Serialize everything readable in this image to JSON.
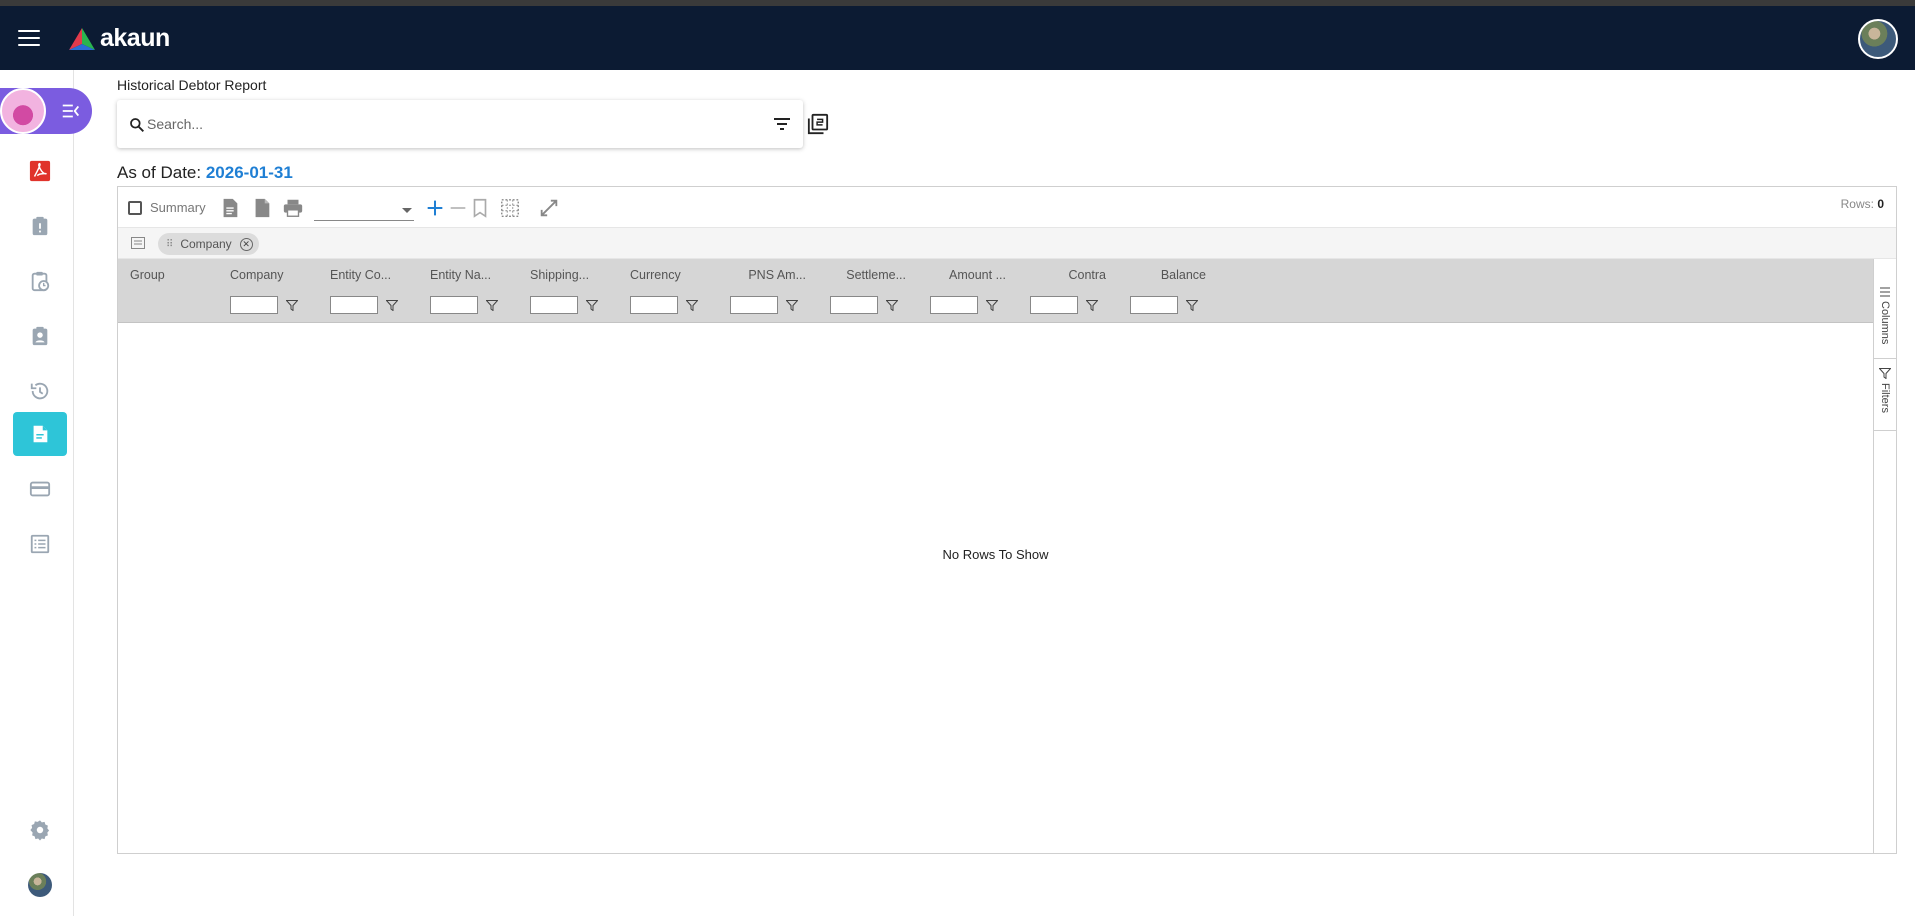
{
  "app": {
    "name": "akaun"
  },
  "colors": {
    "topbar": "#0c1b33",
    "accent": "#2ec5d8",
    "link": "#1f7fd4",
    "badge": "#7b5ce0"
  },
  "sidebar": {
    "items": [
      {
        "icon": "pdf-app-icon"
      },
      {
        "icon": "clipboard-alert-icon"
      },
      {
        "icon": "clipboard-clock-icon"
      },
      {
        "icon": "clipboard-account-icon"
      },
      {
        "icon": "history-icon"
      },
      {
        "icon": "report-icon",
        "active": true
      },
      {
        "icon": "credit-card-icon"
      },
      {
        "icon": "list-icon"
      }
    ],
    "bottom": [
      {
        "icon": "gear-icon"
      },
      {
        "icon": "avatar"
      }
    ]
  },
  "page": {
    "title": "Historical Debtor Report",
    "search_placeholder": "Search...",
    "as_of_label": "As of Date:",
    "as_of_date": "2026-01-31"
  },
  "toolbar": {
    "summary_label": "Summary",
    "rows_label": "Rows:",
    "rows_count": "0"
  },
  "grouping": {
    "chips": [
      "Company"
    ]
  },
  "grid": {
    "columns": [
      "Group",
      "Company",
      "Entity Co...",
      "Entity Na...",
      "Shipping...",
      "Currency",
      "PNS Am...",
      "Settleme...",
      "Amount ...",
      "Contra",
      "Balance"
    ],
    "no_rows": "No Rows To Show",
    "side_tabs": [
      "Columns",
      "Filters"
    ]
  }
}
